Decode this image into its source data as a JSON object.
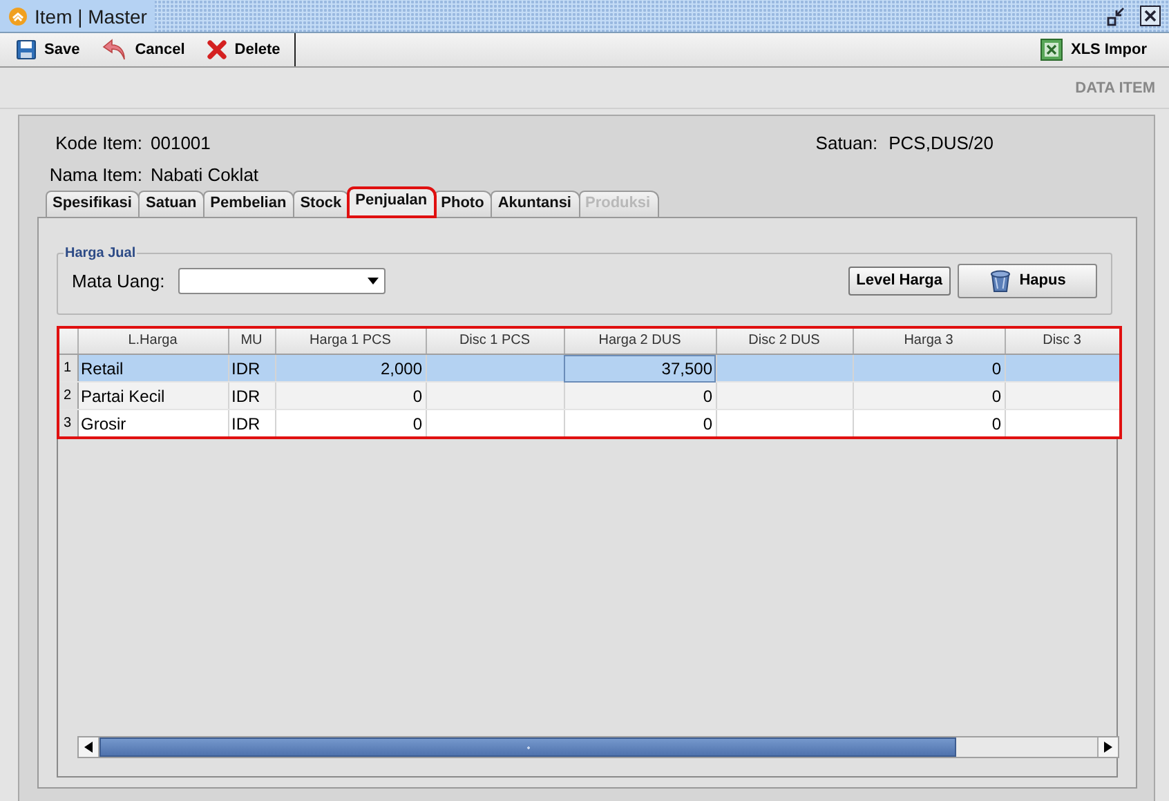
{
  "window": {
    "title": "Item | Master"
  },
  "toolbar": {
    "left": [
      {
        "label": "Save"
      },
      {
        "label": "Cancel"
      },
      {
        "label": "Delete"
      }
    ],
    "right": [
      {
        "label": "XLS Impor"
      }
    ]
  },
  "section_title": "DATA ITEM",
  "fields": [
    {
      "label": "Kode Item:",
      "value": "001001"
    },
    {
      "label": "Nama Item:",
      "value": "Nabati Coklat"
    }
  ],
  "satuan": {
    "label": "Satuan:",
    "value": "PCS,DUS/20"
  },
  "tabs": [
    {
      "label": "Spesifikasi",
      "selected": false,
      "disabled": false,
      "highlighted": false
    },
    {
      "label": "Satuan",
      "selected": false,
      "disabled": false,
      "highlighted": false
    },
    {
      "label": "Pembelian",
      "selected": false,
      "disabled": false,
      "highlighted": false
    },
    {
      "label": "Stock",
      "selected": false,
      "disabled": false,
      "highlighted": false
    },
    {
      "label": "Penjualan",
      "selected": true,
      "disabled": false,
      "highlighted": true
    },
    {
      "label": "Photo",
      "selected": false,
      "disabled": false,
      "highlighted": false
    },
    {
      "label": "Akuntansi",
      "selected": false,
      "disabled": false,
      "highlighted": false
    },
    {
      "label": "Produksi",
      "selected": false,
      "disabled": true,
      "highlighted": false
    }
  ],
  "harga_jual": {
    "title": "Harga Jual",
    "mata_uang": {
      "label": "Mata Uang:"
    },
    "buttons": [
      {
        "label": "Level Harga"
      },
      {
        "label": "Hapus"
      }
    ]
  },
  "table": {
    "highlighted": true,
    "columns": [
      "L.Harga",
      "MU",
      "Harga 1 PCS",
      "Disc 1 PCS",
      "Harga 2 DUS",
      "Disc 2 DUS",
      "Harga 3",
      "Disc 3"
    ],
    "rows": [
      {
        "number": "1",
        "selected": true,
        "cells": [
          {
            "text": "Retail",
            "focused": false
          },
          {
            "text": "IDR",
            "focused": false
          },
          {
            "text": "2,000",
            "focused": false
          },
          {
            "focused": false
          },
          {
            "text": "37,500",
            "focused": true
          },
          {
            "focused": false
          },
          {
            "text": "0",
            "focused": false
          },
          {
            "focused": false
          }
        ]
      },
      {
        "number": "2",
        "selected": false,
        "cells": [
          {
            "text": "Partai Kecil",
            "focused": false
          },
          {
            "text": "IDR",
            "focused": false
          },
          {
            "text": "0",
            "focused": false
          },
          {
            "focused": false
          },
          {
            "text": "0",
            "focused": false
          },
          {
            "focused": false
          },
          {
            "text": "0",
            "focused": false
          },
          {
            "focused": false
          }
        ]
      },
      {
        "number": "3",
        "selected": false,
        "cells": [
          {
            "text": "Grosir",
            "focused": false
          },
          {
            "text": "IDR",
            "focused": false
          },
          {
            "text": "0",
            "focused": false
          },
          {
            "focused": false
          },
          {
            "text": "0",
            "focused": false
          },
          {
            "focused": false
          },
          {
            "text": "0",
            "focused": false
          },
          {
            "focused": false
          }
        ]
      }
    ]
  }
}
